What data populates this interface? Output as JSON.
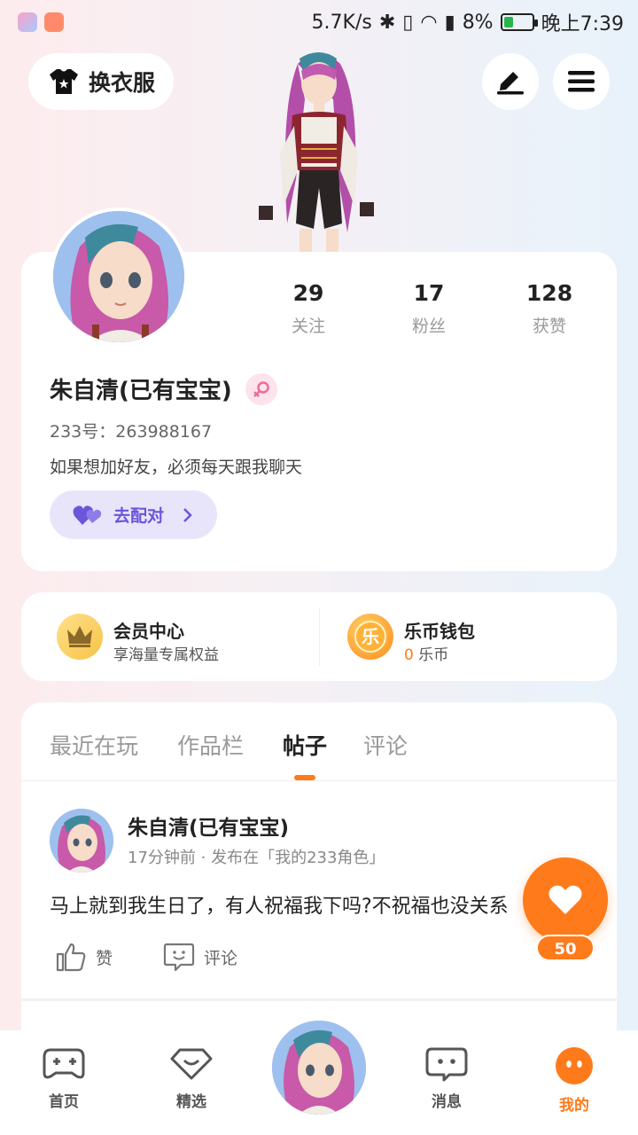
{
  "status_bar": {
    "net_speed": "5.7K/s",
    "battery_pct": "8%",
    "time": "晚上7:39"
  },
  "top": {
    "outfit_label": "换衣服"
  },
  "profile": {
    "name": "朱自清(已有宝宝)",
    "uid": "233号：263988167",
    "bio": "如果想加好友，必须每天跟我聊天",
    "match_label": "去配对",
    "stats": [
      {
        "num": "29",
        "label": "关注"
      },
      {
        "num": "17",
        "label": "粉丝"
      },
      {
        "num": "128",
        "label": "获赞"
      }
    ]
  },
  "member": {
    "title": "会员中心",
    "subtitle": "享海量专属权益"
  },
  "wallet": {
    "title": "乐币钱包",
    "icon_char": "乐",
    "amount": "0",
    "unit": " 乐币"
  },
  "tabs": [
    {
      "label": "最近在玩"
    },
    {
      "label": "作品栏"
    },
    {
      "label": "帖子"
    },
    {
      "label": "评论"
    }
  ],
  "post": {
    "author": "朱自清(已有宝宝)",
    "meta": "17分钟前 · 发布在「我的233角色」",
    "text": "马上就到我生日了，有人祝福我下吗?不祝福也没关系",
    "like_label": "赞",
    "comment_label": "评论"
  },
  "fab": {
    "count": "50"
  },
  "nav": [
    {
      "label": "首页"
    },
    {
      "label": "精选"
    },
    {
      "label": "消息"
    },
    {
      "label": "我的"
    }
  ],
  "colors": {
    "accent": "#ff7a1a",
    "match_purple": "#6b55d8",
    "gender_pink": "#f06a9a"
  }
}
